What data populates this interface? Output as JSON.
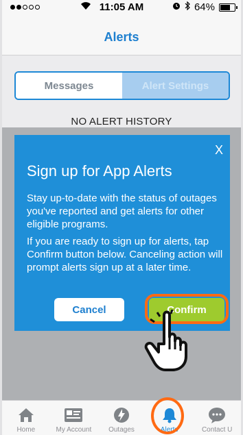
{
  "status_bar": {
    "time": "11:05 AM",
    "battery": "64%",
    "signal_dots_filled": 2,
    "signal_dots_total": 5
  },
  "nav": {
    "title": "Alerts"
  },
  "segments": {
    "messages": "Messages",
    "alert_settings": "Alert Settings"
  },
  "history_text": "NO ALERT HISTORY",
  "dialog": {
    "close": "X",
    "heading": "Sign up for App Alerts",
    "body1": "Stay up-to-date with the status of outages you've reported and get alerts for other eligible programs.",
    "body2": "If you are ready to sign up for alerts, tap Confirm button below. Canceling action will prompt alerts sign up at a later time.",
    "cancel_label": "Cancel",
    "confirm_label": "Confirm"
  },
  "tabs": [
    {
      "label": "Home",
      "icon": "home-icon"
    },
    {
      "label": "My Account",
      "icon": "account-card-icon"
    },
    {
      "label": "Outages",
      "icon": "lightning-icon"
    },
    {
      "label": "Alerts",
      "icon": "bell-icon"
    },
    {
      "label": "Contact U",
      "icon": "chat-bubble-icon"
    }
  ],
  "colors": {
    "accent": "#1d88d6",
    "dialog": "#1f8fd8",
    "confirm": "#9ecb2e",
    "highlight": "#ff6a13"
  }
}
